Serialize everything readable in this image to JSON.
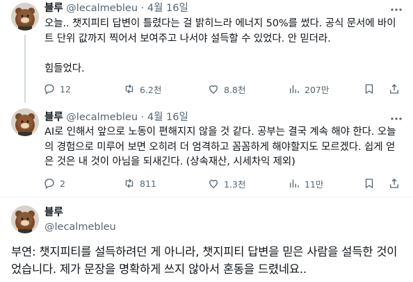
{
  "tweets": [
    {
      "name": "블루",
      "handle": "@lecalmebleu",
      "dot": "·",
      "date": "4월 16일",
      "lines": [
        "오늘.. 챗지피티 답변이 틀렸다는 걸 밝히느라 에너지 50%를 썼다. 공식 문서에 바이",
        "트 단위 값까지 찍어서 보여주고 나서야 설득할 수 있었다. 안 믿더라.",
        "",
        "힘들었다."
      ],
      "stats": {
        "replies": "12",
        "retweets": "6.2천",
        "likes": "8.8천",
        "views": "207만"
      }
    },
    {
      "name": "블루",
      "handle": "@lecalmebleu",
      "dot": "·",
      "date": "4월 16일",
      "lines": [
        "AI로 인해서 앞으로 노동이 편해지지 않을 것 같다. 공부는 결국 계속 해야 한다. 오늘",
        "의 경험으로 미루어 보면 오히려 더 엄격하고 꼼꼼하게 해야할지도 모르겠다. 쉽게 얻",
        "은 것은 내 것이 아님을 되새긴다. (상속재산, 시세차익 제외)"
      ],
      "stats": {
        "replies": "2",
        "retweets": "811",
        "likes": "1.3천",
        "views": "11만"
      }
    }
  ],
  "main": {
    "name": "블루",
    "handle": "@lecalmebleu",
    "lines": [
      "부연: 챗지피티를 설득하려던 게 아니라, 챗지피티 답변을 믿은 사람을 설득한 것이",
      "었습니다. 제가 문장을 명확하게 쓰지 않아서 혼동을 드렸네요.."
    ]
  },
  "icons": {
    "more": "more-horizontal-icon",
    "reply": "reply-icon",
    "retweet": "retweet-icon",
    "like": "heart-icon",
    "views": "views-icon",
    "bookmark": "bookmark-icon",
    "share": "share-icon"
  },
  "colors": {
    "text": "#0f1419",
    "secondary": "#536471",
    "line": "#cfd9de"
  }
}
